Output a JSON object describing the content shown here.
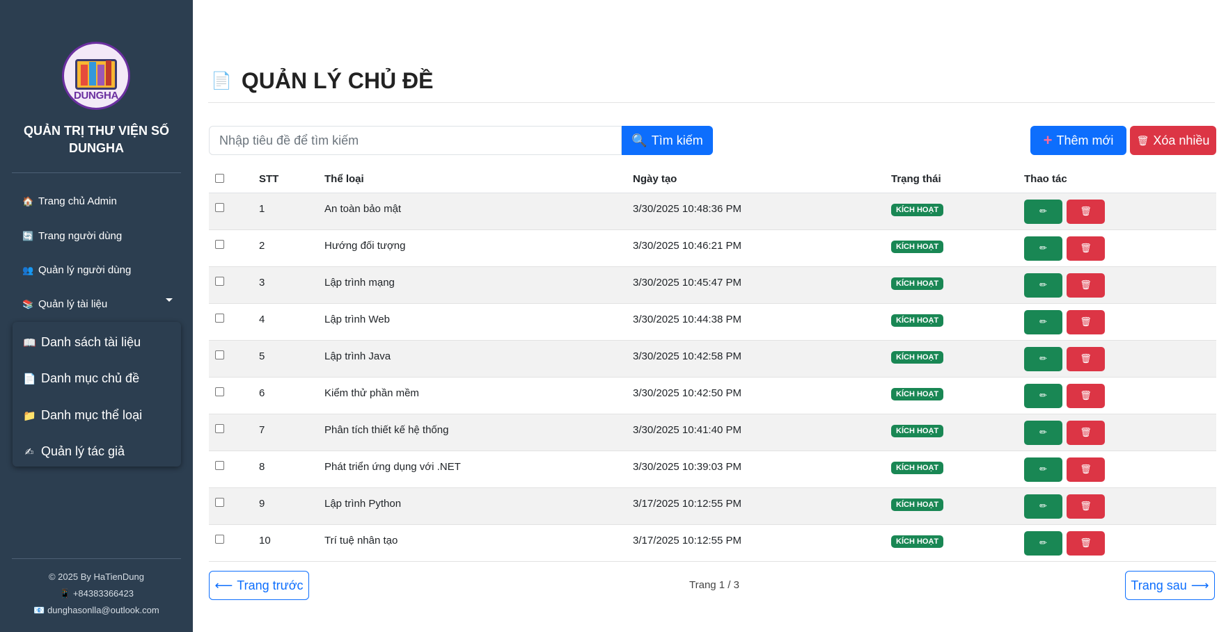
{
  "sidebar": {
    "logo_text": "DUNGHA",
    "brand_line1": "QUẢN TRỊ THƯ VIỆN SỐ",
    "brand_line2": "DUNGHA",
    "nav": [
      {
        "label": "Trang chủ Admin",
        "icon": "house-icon"
      },
      {
        "label": "Trang người dùng",
        "icon": "refresh-icon"
      },
      {
        "label": "Quản lý người dùng",
        "icon": "users-icon"
      },
      {
        "label": "Quản lý tài liệu",
        "icon": "books-icon"
      }
    ],
    "submenu": [
      {
        "label": "Danh sách tài liệu",
        "icon": "book-icon"
      },
      {
        "label": "Danh mục chủ đề",
        "icon": "page-icon"
      },
      {
        "label": "Danh mục thể loại",
        "icon": "folder-icon"
      },
      {
        "label": "Quản lý tác giả",
        "icon": "writing-hand-icon"
      }
    ],
    "footer": {
      "copyright": "© 2025 By HaTienDung",
      "phone": "+84383366423",
      "email": "dunghasonlla@outlook.com"
    }
  },
  "main": {
    "title": "QUẢN LÝ CHỦ ĐỀ",
    "search": {
      "placeholder": "Nhập tiêu đề để tìm kiếm",
      "value": "",
      "button": "Tìm kiếm"
    },
    "add_button": "Thêm mới",
    "delete_many_button": "Xóa nhiều",
    "table": {
      "headers": [
        "STT",
        "Thể loại",
        "Ngày tạo",
        "Trạng thái",
        "Thao tác"
      ],
      "rows": [
        {
          "stt": "1",
          "name": "An toàn bảo mật",
          "date": "3/30/2025 10:48:36 PM",
          "status": "KÍCH HOẠT"
        },
        {
          "stt": "2",
          "name": "Hướng đối tượng",
          "date": "3/30/2025 10:46:21 PM",
          "status": "KÍCH HOẠT"
        },
        {
          "stt": "3",
          "name": "Lập trình mạng",
          "date": "3/30/2025 10:45:47 PM",
          "status": "KÍCH HOẠT"
        },
        {
          "stt": "4",
          "name": "Lập trình Web",
          "date": "3/30/2025 10:44:38 PM",
          "status": "KÍCH HOẠT"
        },
        {
          "stt": "5",
          "name": "Lập trình Java",
          "date": "3/30/2025 10:42:58 PM",
          "status": "KÍCH HOẠT"
        },
        {
          "stt": "6",
          "name": "Kiểm thử phần mềm",
          "date": "3/30/2025 10:42:50 PM",
          "status": "KÍCH HOẠT"
        },
        {
          "stt": "7",
          "name": "Phân tích thiết kế hệ thống",
          "date": "3/30/2025 10:41:40 PM",
          "status": "KÍCH HOẠT"
        },
        {
          "stt": "8",
          "name": "Phát triển ứng dụng với .NET",
          "date": "3/30/2025 10:39:03 PM",
          "status": "KÍCH HOẠT"
        },
        {
          "stt": "9",
          "name": "Lập trình Python",
          "date": "3/17/2025 10:12:55 PM",
          "status": "KÍCH HOẠT"
        },
        {
          "stt": "10",
          "name": "Trí tuệ nhân tạo",
          "date": "3/17/2025 10:12:55 PM",
          "status": "KÍCH HOẠT"
        }
      ]
    },
    "pagination": {
      "prev": "Trang trước",
      "info": "Trang 1 / 3",
      "next": "Trang sau"
    }
  },
  "colors": {
    "sidebar_bg": "#2c3e50",
    "primary": "#0d6efd",
    "danger": "#dc3545",
    "success": "#198754"
  }
}
